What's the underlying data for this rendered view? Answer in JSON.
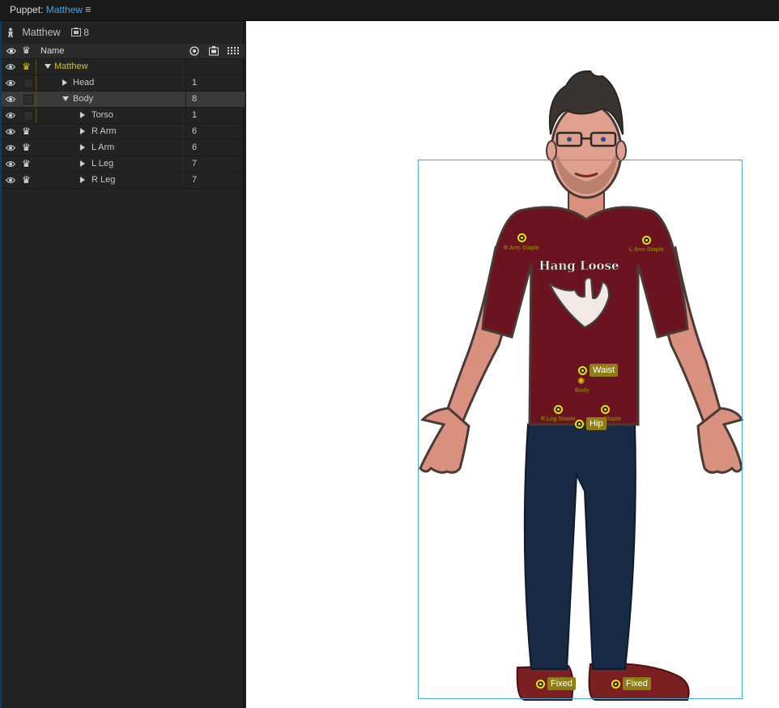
{
  "header": {
    "title_prefix": "Puppet: ",
    "title_name": "Matthew",
    "menu_icon": "hamburger-icon"
  },
  "puppet": {
    "name": "Matthew",
    "count": "8"
  },
  "columns": {
    "name": "Name"
  },
  "rows": [
    {
      "label": "Matthew",
      "count": "",
      "indent": 0,
      "expanded": true,
      "crown": "gold"
    },
    {
      "label": "Head",
      "count": "1",
      "indent": 1,
      "expanded": false,
      "crown": "none"
    },
    {
      "label": "Body",
      "count": "8",
      "indent": 1,
      "expanded": true,
      "crown": "none",
      "selected": true
    },
    {
      "label": "Torso",
      "count": "1",
      "indent": 2,
      "expanded": false,
      "crown": "none"
    },
    {
      "label": "R Arm",
      "count": "6",
      "indent": 2,
      "expanded": false,
      "crown": "white"
    },
    {
      "label": "L Arm",
      "count": "6",
      "indent": 2,
      "expanded": false,
      "crown": "white"
    },
    {
      "label": "L Leg",
      "count": "7",
      "indent": 2,
      "expanded": false,
      "crown": "white"
    },
    {
      "label": "R Leg",
      "count": "7",
      "indent": 2,
      "expanded": false,
      "crown": "white"
    }
  ],
  "artwork": {
    "shirt_text": "Hang Loose",
    "handles": {
      "r_arm_staple": "R Arm Staple",
      "l_arm_staple": "L Arm Staple",
      "waist": "Waist",
      "body": "Body",
      "r_leg_staple": "R Leg Staple",
      "l_leg_staple": "Staple",
      "hip": "Hip",
      "fixed_left": "Fixed",
      "fixed_right": "Fixed"
    }
  },
  "colors": {
    "accent": "#4aa3df",
    "gold": "#d6c21a",
    "shirt": "#6b1420",
    "jeans": "#182a44",
    "selection": "#45a9d6"
  }
}
